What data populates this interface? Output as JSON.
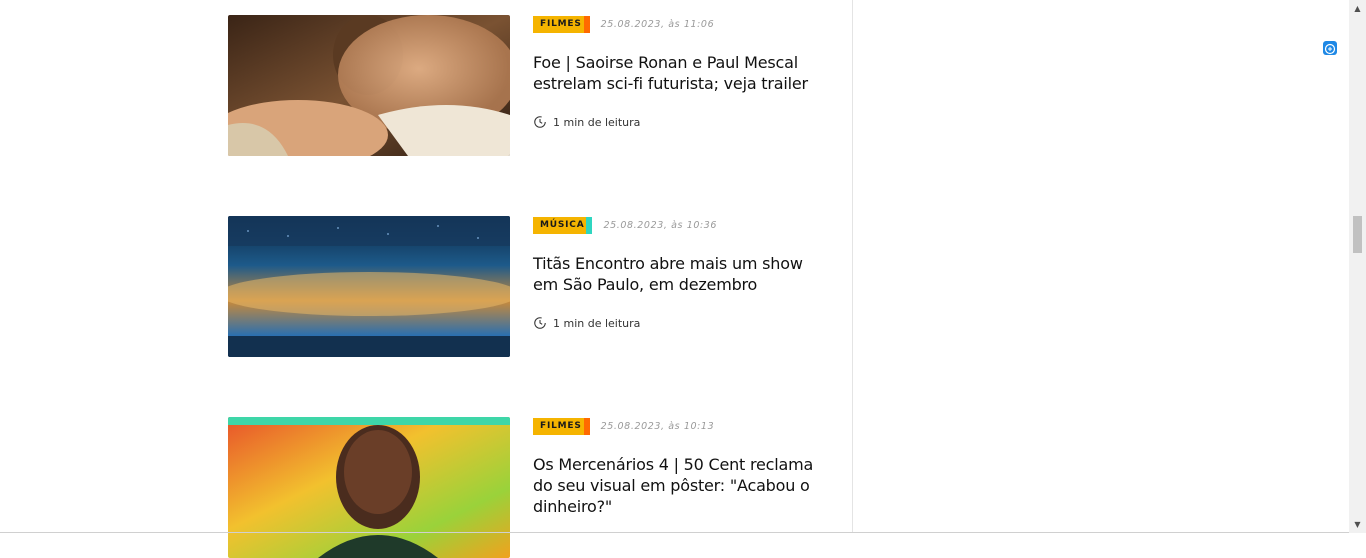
{
  "articles": [
    {
      "category": "FILMES",
      "category_color": "#f5b400",
      "stripe_color": "#ff6a00",
      "date": "25.08.2023, às 11:06",
      "title": "Foe | Saoirse Ronan e Paul Mescal estrelam sci-fi futurista; veja trailer",
      "reading_time": "1 min de leitura"
    },
    {
      "category": "MÚSICA",
      "category_color": "#f5b400",
      "stripe_color": "#2fd6c0",
      "date": "25.08.2023, às 10:36",
      "title": "Titãs Encontro abre mais um show em São Paulo, em dezembro",
      "reading_time": "1 min de leitura"
    },
    {
      "category": "FILMES",
      "category_color": "#f5b400",
      "stripe_color": "#ff6a00",
      "date": "25.08.2023, às 10:13",
      "title": "Os Mercenários 4 | 50 Cent reclama do seu visual em pôster: \"Acabou o dinheiro?\"",
      "reading_time": ""
    }
  ],
  "icons": {
    "clock": "clock-icon",
    "extension": "extension-icon",
    "scroll_up": "▲",
    "scroll_down": "▼"
  }
}
